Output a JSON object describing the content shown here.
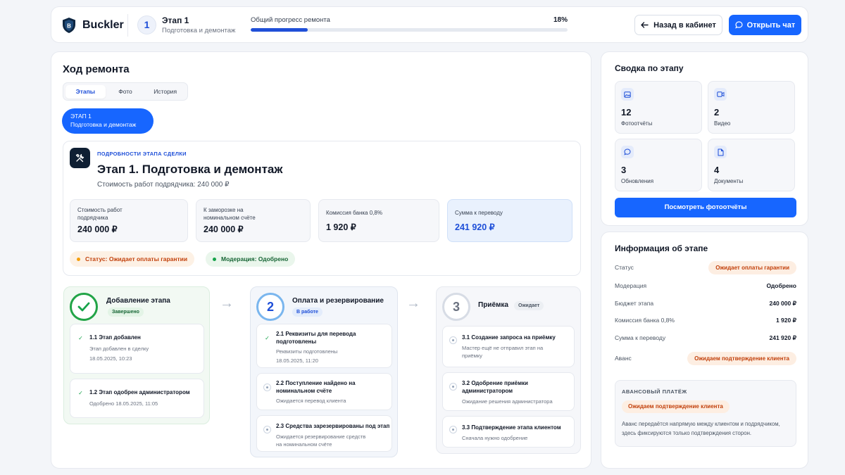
{
  "header": {
    "brand": "Buckler",
    "stage_number": "1",
    "stage_title": "Этап 1",
    "stage_subtitle": "Подготовка и демонтаж",
    "progress_label": "Общий прогресс ремонта",
    "progress_text": "18%",
    "progress_value": 0.18,
    "back_button": "Назад в кабинет",
    "chat_button": "Открыть чат"
  },
  "main": {
    "title": "Ход ремонта",
    "tabs": [
      {
        "label": "Этапы",
        "active": true
      },
      {
        "label": "Фото",
        "active": false
      },
      {
        "label": "История",
        "active": false
      }
    ],
    "stage_pill": {
      "line1": "ЭТАП 1",
      "line2": "Подготовка и демонтаж"
    },
    "details": {
      "eyebrow": "ПОДРОБНОСТИ ЭТАПА СДЕЛКИ",
      "title": "Этап 1. Подготовка и демонтаж",
      "subtitle": "Стоимость работ подрядчика: 240 000 ₽",
      "kpis": [
        {
          "label": "Стоимость работ подрядчика",
          "value": "240 000 ₽"
        },
        {
          "label": "К заморозке на номинальном счёте",
          "value": "240 000 ₽"
        },
        {
          "label": "Комиссия банка 0,8%",
          "value": "1 920 ₽"
        },
        {
          "label": "Сумма к переводу",
          "value": "241 920 ₽"
        }
      ],
      "status_badge": "Статус: Ожидает оплаты гарантии",
      "moderation_badge": "Модерация: Одобрено"
    },
    "columns": [
      {
        "number": "✓",
        "title": "Добавление этапа",
        "badge": "Завершено",
        "items": [
          {
            "title": "1.1 Этап добавлен",
            "subtitle": "Этап добавлен в сделку",
            "date": "18.05.2025, 10:23"
          },
          {
            "title": "1.2 Этап одобрен администратором",
            "subtitle": "Одобрено 18.05.2025, 11:05"
          }
        ]
      },
      {
        "number": "2",
        "title": "Оплата и резервирование",
        "badge": "В работе",
        "items": [
          {
            "title1": "2.1 Реквизиты для перевода",
            "title2": "подготовлены",
            "subtitle": "Реквизиты подготовлены",
            "date": "18.05.2025, 11:20"
          },
          {
            "title1": "2.2 Поступление найдено на",
            "title2": "номинальном счёте",
            "subtitle": "Ожидается перевод клиента"
          },
          {
            "title": "2.3 Средства зарезервированы под этап",
            "subtitle1": "Ожидается резервирование средств",
            "subtitle2": "на номинальном счёте"
          }
        ]
      },
      {
        "number": "3",
        "title": "Приёмка",
        "badge": "Ожидает",
        "items": [
          {
            "title": "3.1 Создание запроса на приёмку",
            "subtitle1": "Мастер ещё не отправил этап на",
            "subtitle2": "приёмку"
          },
          {
            "title1": "3.2 Одобрение приёмки",
            "title2": "администратором",
            "subtitle": "Ожидание решения администратора"
          },
          {
            "title": "3.3 Подтверждение этапа клиентом",
            "subtitle": "Сначала нужно одобрение"
          }
        ]
      }
    ]
  },
  "summary": {
    "title": "Сводка по этапу",
    "stats": [
      {
        "value": "12",
        "label": "Фотоотчёты",
        "icon": "image-icon"
      },
      {
        "value": "2",
        "label": "Видео",
        "icon": "video-icon"
      },
      {
        "value": "3",
        "label": "Обновления",
        "icon": "message-icon"
      },
      {
        "value": "4",
        "label": "Документы",
        "icon": "document-icon"
      }
    ],
    "button": "Посмотреть фотоотчёты"
  },
  "info": {
    "title": "Информация об этапе",
    "rows": [
      {
        "key": "Статус",
        "value": "Ожидает оплаты гарантии"
      },
      {
        "key": "Модерация",
        "value": "Одобрено"
      },
      {
        "key": "Бюджет этапа",
        "value": "240 000 ₽"
      },
      {
        "key": "Комиссия банка 0,8%",
        "value": "1 920 ₽"
      },
      {
        "key": "Сумма к переводу",
        "value": "241 920 ₽"
      },
      {
        "key": "Аванс",
        "value": "Ожидаем подтверждение клиента"
      }
    ],
    "advance": {
      "heading": "АВАНСОВЫЙ ПЛАТЁЖ",
      "pill": "Ожидаем подтверждение клиента",
      "description": "Аванс передаётся напрямую между клиентом и подрядчиком, здесь фиксируются только подтверждения сторон."
    }
  },
  "colors": {
    "accent": "#1766ff",
    "success": "#16a34a",
    "warning": "#c2410c",
    "warning_bg": "#fdeee2"
  }
}
